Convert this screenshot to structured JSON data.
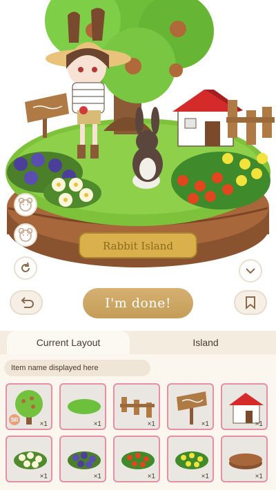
{
  "game": {
    "plaque_text": "Rabbit Island",
    "done_label": "I'm done!"
  },
  "tabs": [
    {
      "label": "Current Layout",
      "active": true
    },
    {
      "label": "Island",
      "active": false
    }
  ],
  "item_name_placeholder": "Item name displayed here",
  "items": [
    {
      "name": "fruit-tree",
      "qty": "×1",
      "rarity": "SR"
    },
    {
      "name": "grass-patch",
      "qty": "×1"
    },
    {
      "name": "wooden-fence",
      "qty": "×1"
    },
    {
      "name": "wooden-signpost",
      "qty": "×1"
    },
    {
      "name": "red-roof-house",
      "qty": "×1"
    },
    {
      "name": "white-flowers",
      "qty": "×1"
    },
    {
      "name": "purple-flowers",
      "qty": "×1"
    },
    {
      "name": "red-flowers",
      "qty": "×1"
    },
    {
      "name": "yellow-flowers",
      "qty": "×1"
    },
    {
      "name": "island-base",
      "qty": "×1"
    }
  ]
}
